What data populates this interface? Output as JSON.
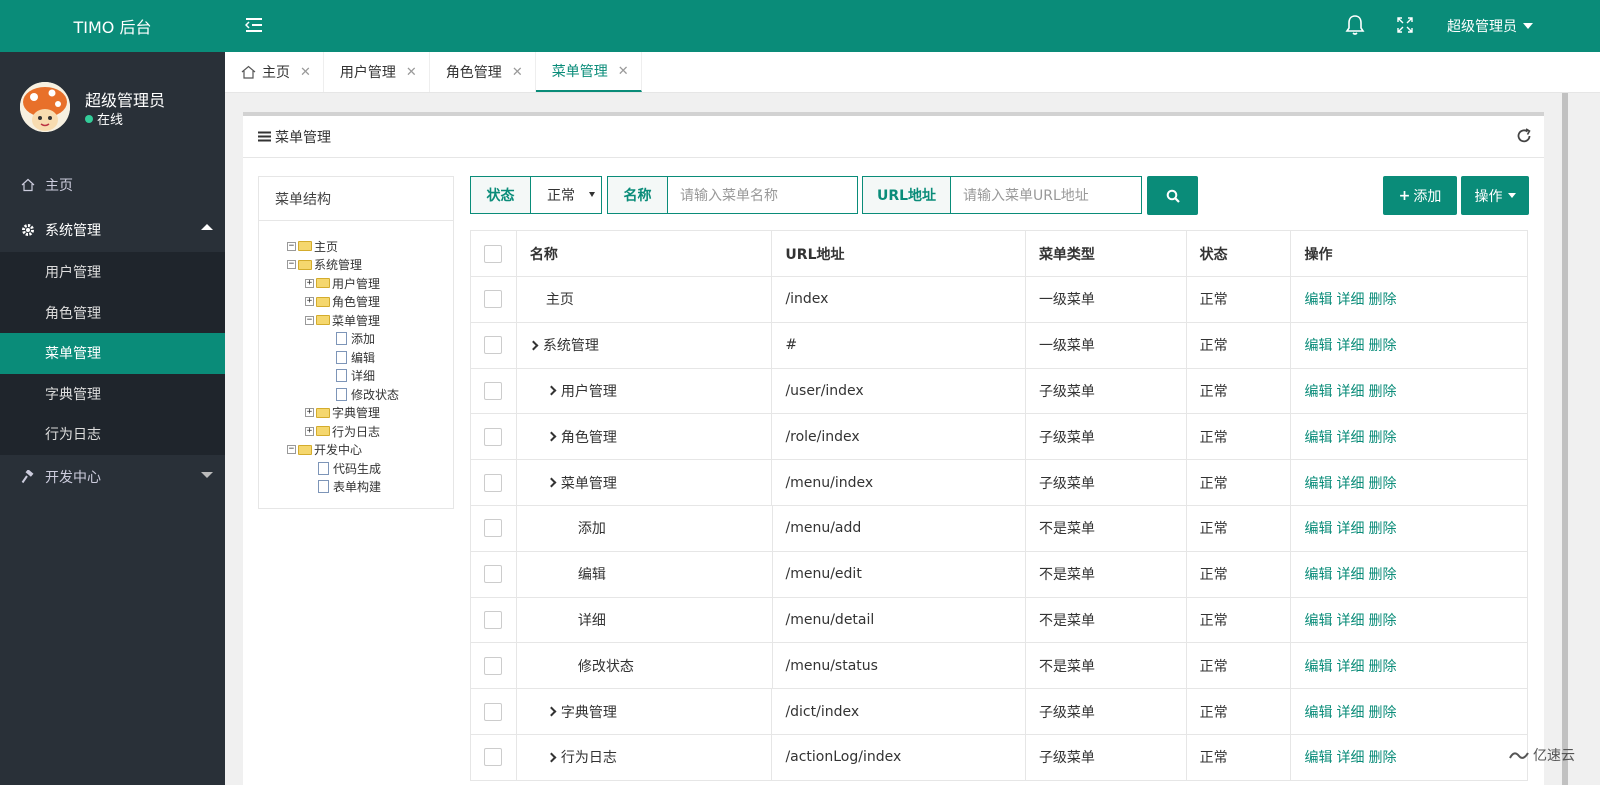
{
  "app": {
    "title": "TIMO 后台"
  },
  "user": {
    "name": "超级管理员",
    "status": "在线"
  },
  "sidebar": {
    "home": "主页",
    "system": "系统管理",
    "sub": [
      "用户管理",
      "角色管理",
      "菜单管理",
      "字典管理",
      "行为日志"
    ],
    "dev": "开发中心"
  },
  "header": {
    "user": "超级管理员"
  },
  "tabs": [
    "主页",
    "用户管理",
    "角色管理",
    "菜单管理"
  ],
  "panel": {
    "title": "菜单管理"
  },
  "tree": {
    "title": "菜单结构",
    "nodes": [
      "主页",
      "系统管理",
      "用户管理",
      "角色管理",
      "菜单管理",
      "添加",
      "编辑",
      "详细",
      "修改状态",
      "字典管理",
      "行为日志",
      "开发中心",
      "代码生成",
      "表单构建"
    ]
  },
  "search": {
    "status_label": "状态",
    "status_value": "正常",
    "name_label": "名称",
    "name_placeholder": "请输入菜单名称",
    "url_label": "URL地址",
    "url_placeholder": "请输入菜单URL地址"
  },
  "buttons": {
    "add": "添加",
    "ops": "操作"
  },
  "table": {
    "headers": [
      "名称",
      "URL地址",
      "菜单类型",
      "状态",
      "操作"
    ],
    "rows": [
      {
        "name": "主页",
        "url": "/index",
        "type": "一级菜单",
        "status": "正常"
      },
      {
        "name": "系统管理",
        "url": "#",
        "type": "一级菜单",
        "status": "正常"
      },
      {
        "name": "用户管理",
        "url": "/user/index",
        "type": "子级菜单",
        "status": "正常"
      },
      {
        "name": "角色管理",
        "url": "/role/index",
        "type": "子级菜单",
        "status": "正常"
      },
      {
        "name": "菜单管理",
        "url": "/menu/index",
        "type": "子级菜单",
        "status": "正常"
      },
      {
        "name": "添加",
        "url": "/menu/add",
        "type": "不是菜单",
        "status": "正常"
      },
      {
        "name": "编辑",
        "url": "/menu/edit",
        "type": "不是菜单",
        "status": "正常"
      },
      {
        "name": "详细",
        "url": "/menu/detail",
        "type": "不是菜单",
        "status": "正常"
      },
      {
        "name": "修改状态",
        "url": "/menu/status",
        "type": "不是菜单",
        "status": "正常"
      },
      {
        "name": "字典管理",
        "url": "/dict/index",
        "type": "子级菜单",
        "status": "正常"
      },
      {
        "name": "行为日志",
        "url": "/actionLog/index",
        "type": "子级菜单",
        "status": "正常"
      }
    ],
    "ops": {
      "edit": "编辑",
      "detail": "详细",
      "delete": "删除"
    }
  },
  "watermark": "亿速云"
}
